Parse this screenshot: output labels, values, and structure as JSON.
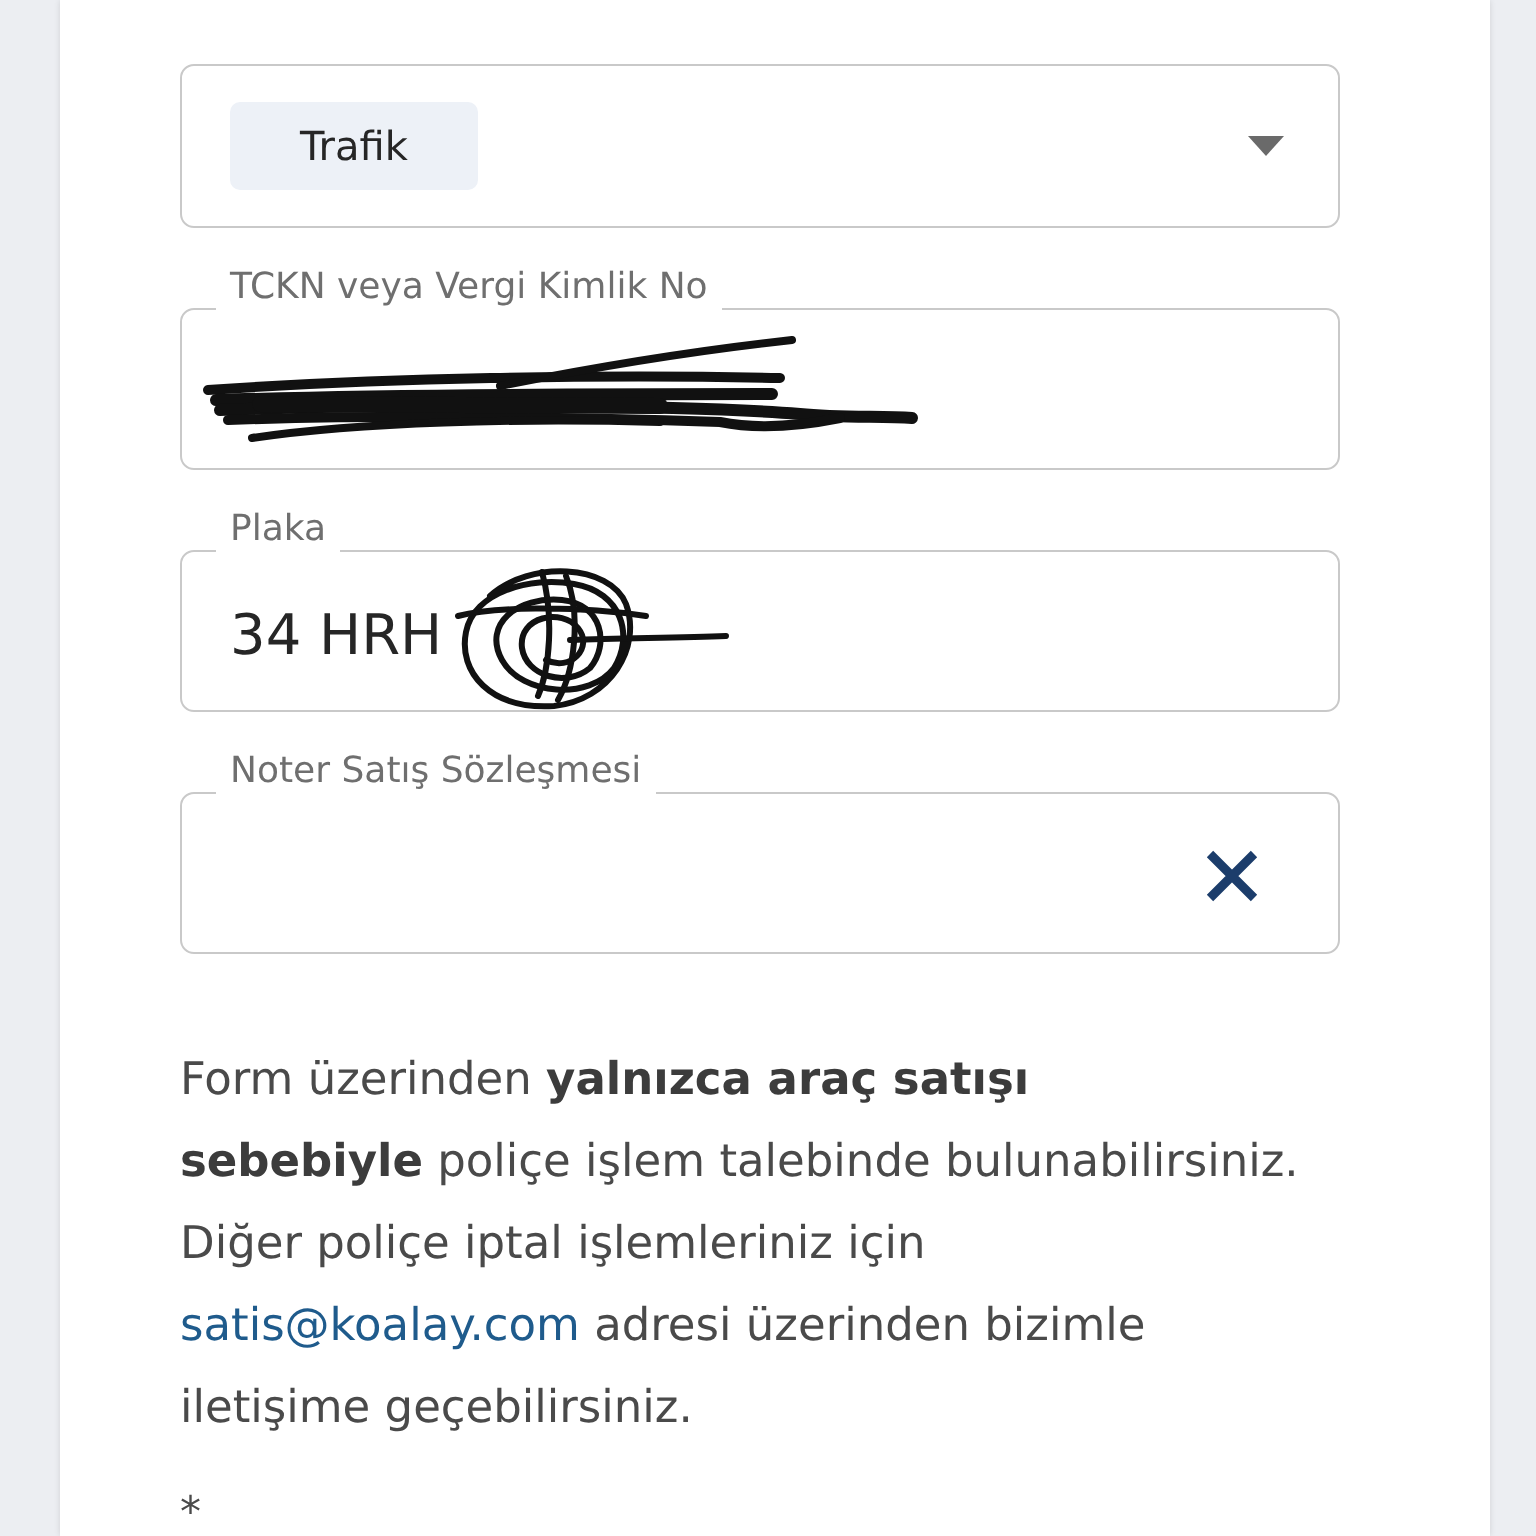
{
  "form": {
    "fields": [
      {
        "kind": "select",
        "value": "Trafik"
      },
      {
        "kind": "text",
        "label": "TCKN veya Vergi Kimlik No",
        "redacted": true
      },
      {
        "kind": "text",
        "label": "Plaka",
        "value": "34 HRH",
        "redacted": true
      },
      {
        "kind": "upload",
        "label": "Noter Satış Sözleşmesi"
      }
    ]
  },
  "notice": {
    "text": "Form üzerinden **yalnızca araç satışı**\n**sebebiyle** poliçe işlem talebinde bulunabilirsiniz.\nDiğer poliçe iptal işlemleriniz için\n",
    "link": "satis@koalay.com",
    "text_after": "adresi üzerinden bizimle\niletişime geçebilirsiniz."
  },
  "footnote": "*"
}
